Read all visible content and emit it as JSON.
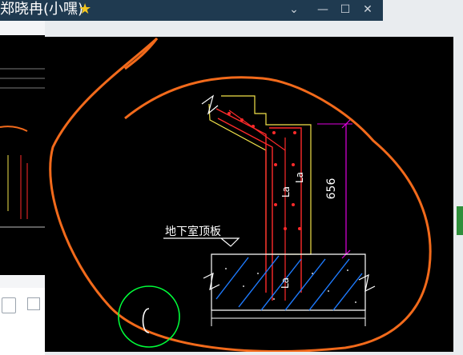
{
  "window": {
    "title": "郑晓冉(小嘿)",
    "star_icon": "star-icon",
    "controls": [
      "chevron-down-icon",
      "minimize-icon",
      "maximize-icon",
      "close-icon"
    ]
  },
  "drawing": {
    "label_slab": "地下室顶板",
    "dimension_656": "656",
    "label_la_1": "La",
    "label_la_2": "La",
    "label_la_3": "La"
  },
  "colors": {
    "titlebar": "#1f3a50",
    "annotation_orange": "#f26a1b",
    "cad_magenta": "#e000e0",
    "cad_yellow": "#f2e24a",
    "cad_red": "#ff2a2a",
    "cursor_green": "#00ff3a"
  }
}
